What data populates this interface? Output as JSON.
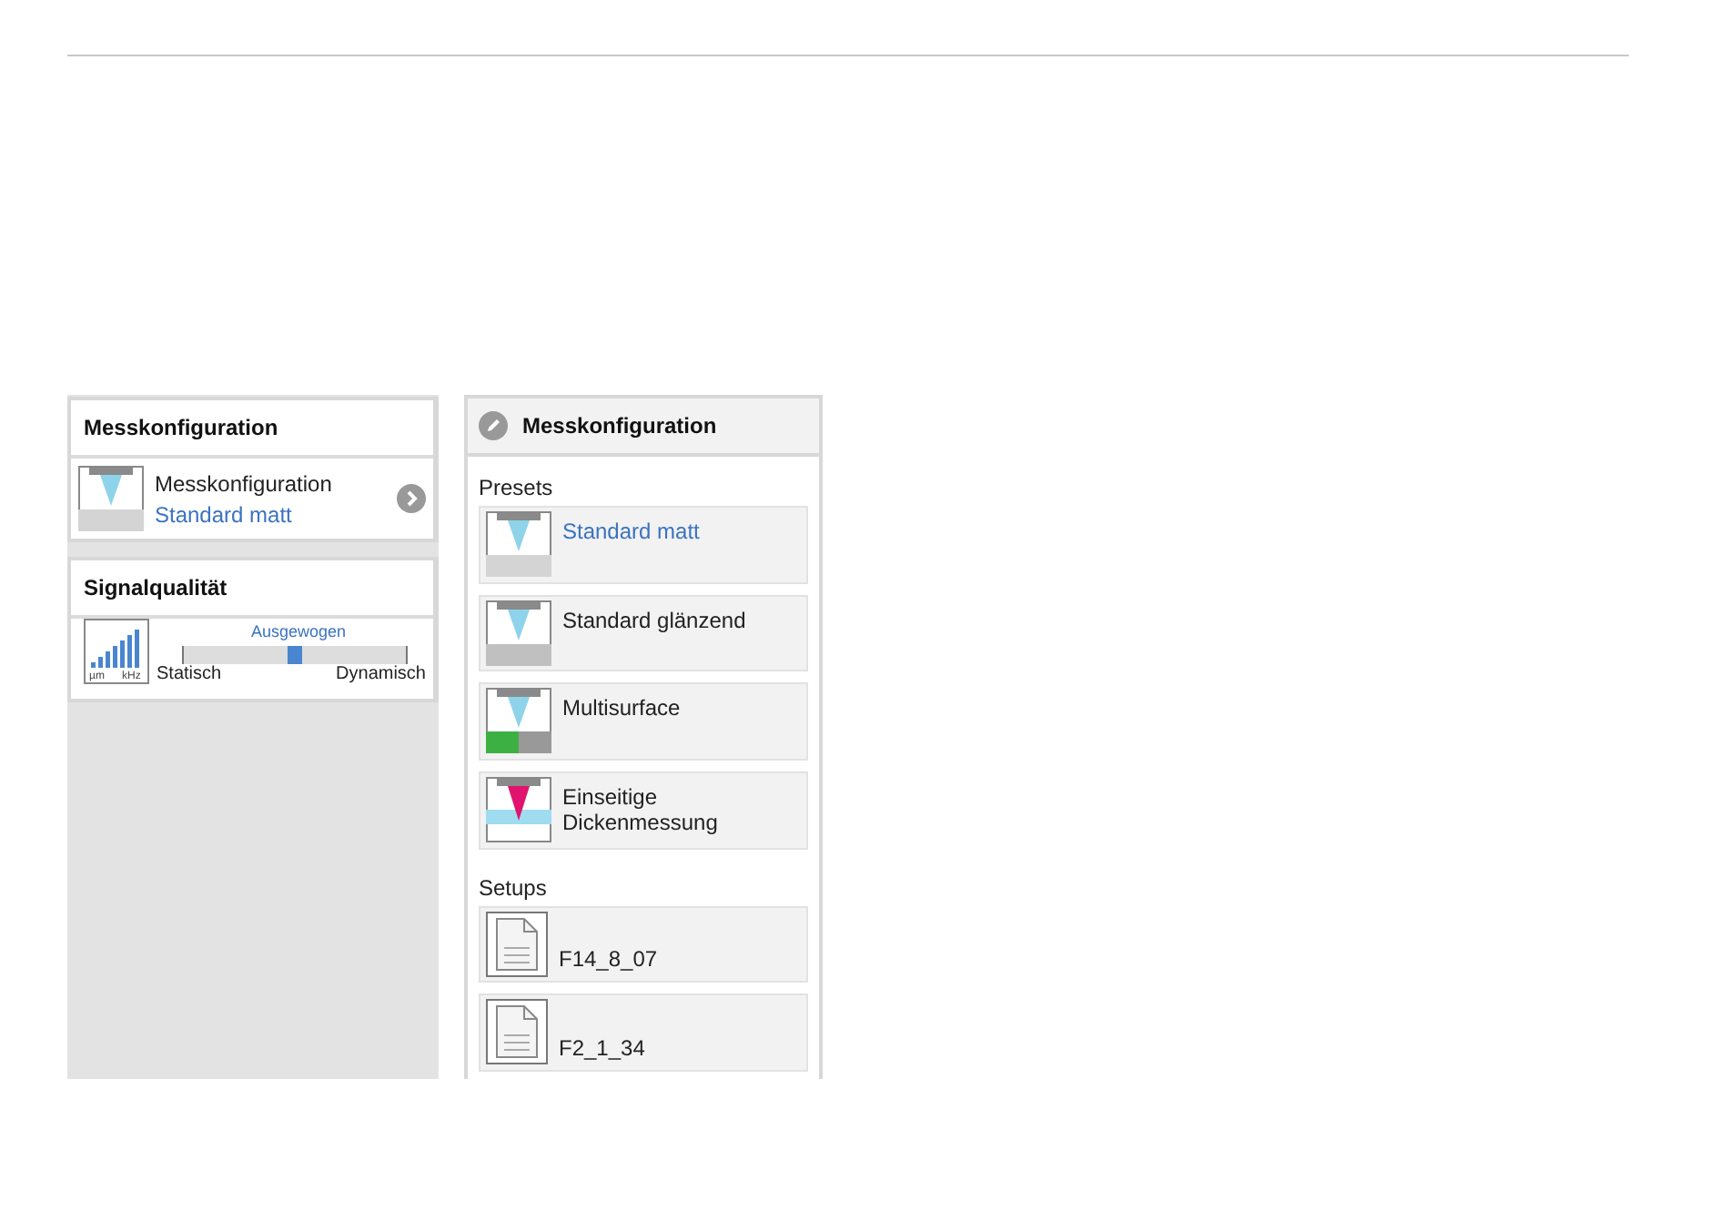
{
  "config_card": {
    "title": "Messkonfiguration",
    "label": "Messkonfiguration",
    "value": "Standard matt"
  },
  "signal_card": {
    "title": "Signalqualität",
    "slider_label": "Ausgewogen",
    "level": 0.5,
    "min_label": "Statisch",
    "max_label": "Dynamisch",
    "icon_labels": [
      "µm",
      "kHz"
    ]
  },
  "panel": {
    "title": "Messkonfiguration",
    "sections": [
      {
        "title": "Presets",
        "items": [
          {
            "label": "Standard matt",
            "kind": "matt",
            "selected": true
          },
          {
            "label": "Standard glänzend",
            "kind": "glossy",
            "selected": false
          },
          {
            "label": "Multisurface",
            "kind": "multisurface",
            "selected": false
          },
          {
            "label": "Einseitige Dickenmessung",
            "kind": "thickness",
            "selected": false
          }
        ]
      },
      {
        "title": "Setups",
        "items": [
          {
            "label": "F14_8_07",
            "kind": "file",
            "selected": false
          },
          {
            "label": "F2_1_34",
            "kind": "file",
            "selected": false
          }
        ]
      }
    ]
  }
}
